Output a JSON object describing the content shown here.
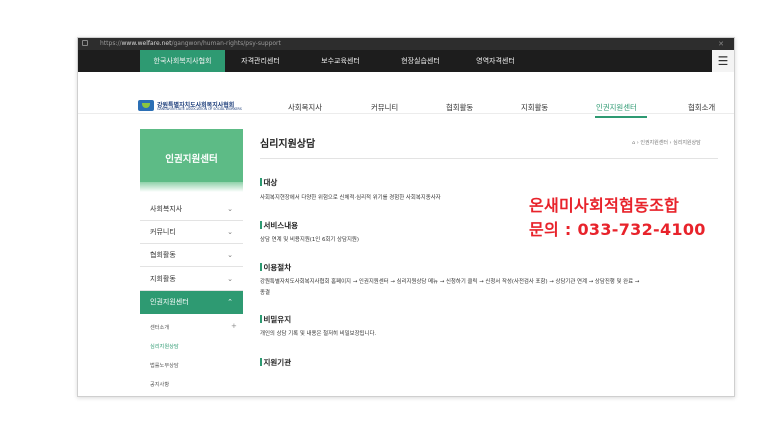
{
  "browser": {
    "url_prefix": "https://",
    "url_host": "www.welfare.net",
    "url_path": "/gangwon/human-rights/psy-support"
  },
  "topnav": {
    "tabs": [
      "한국사회복지사협회",
      "자격관리센터",
      "보수교육센터",
      "현장실습센터",
      "영역자격센터"
    ],
    "active": "한국사회복지사협회",
    "menu_icon": "hamburger-icon"
  },
  "logo": {
    "name": "강원특별자치도사회복지사협회",
    "sub": "GANGWON STATE ASSOCIATION OF SOCIAL WORKERS"
  },
  "mainnav": {
    "items": [
      "사회복지사",
      "커뮤니티",
      "협회활동",
      "지회활동",
      "인권지원센터",
      "협회소개"
    ],
    "active": "인권지원센터"
  },
  "sidebar": {
    "title": "인권지원센터",
    "items": [
      "사회복지사",
      "커뮤니티",
      "협회활동",
      "지회활동",
      "인권지원센터"
    ],
    "sub_items": [
      "센터소개",
      "심리지원상담",
      "법률노무상담",
      "공지사항"
    ],
    "active_sub": "심리지원상담"
  },
  "content": {
    "title": "심리지원상담",
    "breadcrumb": "⌂ › 인권지원센터 › 심리지원상담",
    "sections": [
      {
        "heading": "대상",
        "lines": [
          "사회복지현장에서 다양한 위험으로 신체적·심리적 위기를 경험한 사회복지종사자"
        ]
      },
      {
        "heading": "서비스내용",
        "lines": [
          "상담 연계 및 비용지원(1인 6회기 상담지원)"
        ]
      },
      {
        "heading": "이용절차",
        "lines": [
          "강원특별자치도사회복지사협회 홈페이지 → 인권지원센터 → 심리지원상담 메뉴 → 신청하기 클릭 → 신청서 작성(사전검사 포함) → 상담기관 연계 → 상담진행 및 완료 →",
          "종결"
        ]
      },
      {
        "heading": "비밀유지",
        "lines": [
          "개인의 상담 기록 및 내용은 철저히 비밀보장됩니다."
        ]
      },
      {
        "heading": "지원기관",
        "lines": []
      }
    ]
  },
  "overlay": {
    "org": "온새미사회적협동조합",
    "contact": "문의 : 033-732-4100",
    "color": "#e8232b"
  },
  "colors": {
    "accent": "#2e9a72",
    "sidebar_head": "#5dbb86",
    "topnav_bg": "#1d1d1d"
  }
}
